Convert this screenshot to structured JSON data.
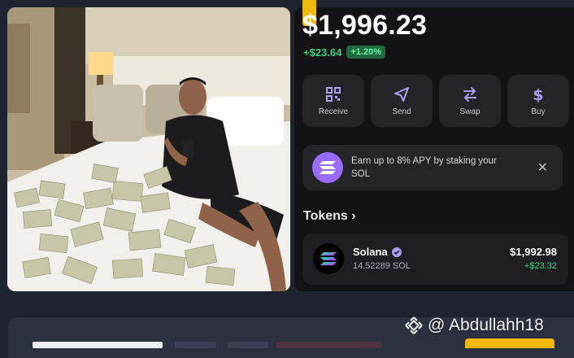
{
  "wallet": {
    "balance": "$1,996.23",
    "change_value": "+$23.64",
    "change_percent": "+1.20%",
    "positive_color": "#3ed083",
    "actions": [
      {
        "label": "Receive",
        "icon": "qr-code-icon"
      },
      {
        "label": "Send",
        "icon": "paper-plane-icon"
      },
      {
        "label": "Swap",
        "icon": "swap-arrows-icon"
      },
      {
        "label": "Buy",
        "icon": "dollar-icon"
      }
    ],
    "earn_banner": {
      "text": "Earn up to 8% APY by staking your SOL",
      "close": "✕"
    },
    "tokens_header": "Tokens",
    "tokens": [
      {
        "name": "Solana",
        "amount": "14.52289 SOL",
        "value": "$1,992.98",
        "change": "+$23.32"
      }
    ]
  },
  "watermark": {
    "handle": "@ Abdullahh18"
  },
  "brand_colors": {
    "accent_yellow": "#f0b90b",
    "solana_purple": "#9a6bff"
  }
}
